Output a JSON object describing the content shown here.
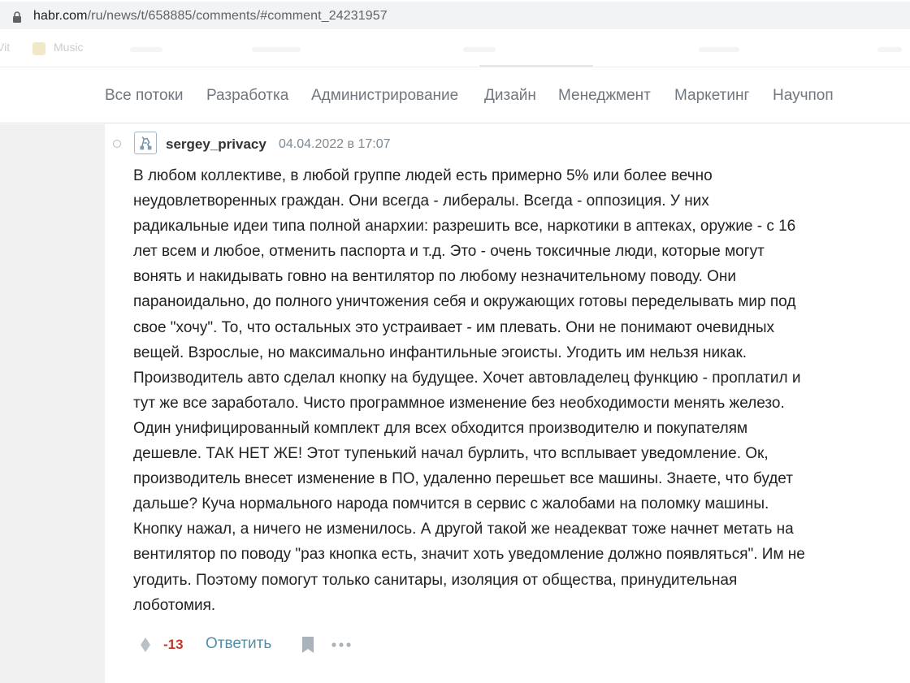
{
  "browser": {
    "url_host": "habr.com",
    "url_path": "/ru/news/t/658885/comments/#comment_24231957",
    "bookmarks": [
      "Vit",
      "Music"
    ]
  },
  "nav": {
    "items": [
      "Все потоки",
      "Разработка",
      "Администрирование",
      "Дизайн",
      "Менеджмент",
      "Маркетинг",
      "Научпоп"
    ]
  },
  "comment": {
    "username": "sergey_privacy",
    "timestamp": "04.04.2022 в 17:07",
    "lines": [
      "В любом коллективе, в любой группе людей есть примерно 5% или более вечно",
      "неудовлетворенных граждан. Они всегда - либералы. Всегда - оппозиция. У них",
      "радикальные идеи типа полной анархии: разрешить все, наркотики в аптеках, оружие - с 16",
      "лет всем и любое, отменить паспорта и т.д. Это - очень токсичные люди, которые могут",
      "вонять и накидывать говно на вентилятор по любому незначительному поводу. Они",
      "параноидально, до полного уничтожения себя и окружающих готовы переделывать мир под",
      "свое \"хочу\". То, что остальных это устраивает - им плевать. Они не понимают очевидных",
      "вещей. Взрослые, но максимально инфантильные эгоисты. Угодить им нельзя никак.",
      "Производитель авто сделал кнопку на будущее. Хочет автовладелец функцию - проплатил и",
      "тут же все заработало. Чисто программное изменение без необходимости менять железо.",
      "Один унифицированный комплект для всех обходится производителю и покупателям",
      "дешевле. ТАК НЕТ ЖЕ! Этот тупенький начал бурлить, что всплывает уведомление. Ок,",
      "производитель внесет изменение в ПО, удаленно перешьет все машины. Знаете, что будет",
      "дальше? Куча нормального народа помчится в сервис с жалобами на поломку машины.",
      "Кнопку нажал, а ничего не изменилось. А другой такой же неадекват тоже начнет метать на",
      "вентилятор по поводу \"раз кнопка есть, значит хоть уведомление должно появляться\". Им не",
      "угодить. Поэтому помогут только санитары, изоляция от общества, принудительная",
      "лоботомия."
    ],
    "score": "-13",
    "reply_label": "Ответить"
  },
  "colors": {
    "score_negative": "#c0392b",
    "reply_link": "#548eaa",
    "nav_text": "#6f7780"
  },
  "icons": [
    "lock-icon",
    "avatar-icon",
    "vote-icon",
    "bookmark-icon",
    "more-icon"
  ]
}
